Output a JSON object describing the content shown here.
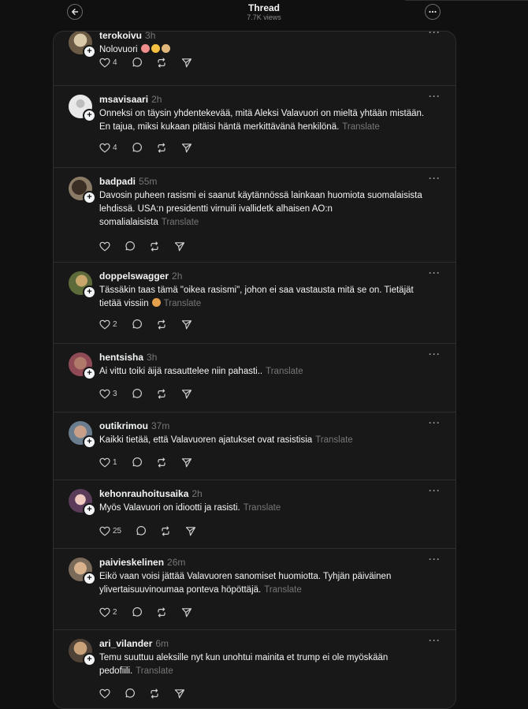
{
  "header": {
    "title": "Thread",
    "views": "7.7K views"
  },
  "posts": [
    {
      "user": "terokoivu",
      "time": "3h",
      "text": "Nolovuori",
      "translate": "",
      "likes": "4",
      "emoji": [
        "#f08d8d",
        "#f6c041",
        "#e0b67a"
      ]
    },
    {
      "user": "msavisaari",
      "time": "2h",
      "text": "Onneksi on täysin yhdentekevää, mitä Aleksi Valavuori on mieltä yhtään mistään. En tajua, miksi kukaan pitäisi häntä merkittävänä henkilönä.",
      "translate": "Translate",
      "likes": "4",
      "emoji": []
    },
    {
      "user": "badpadi",
      "time": "55m",
      "text": "Davosin puheen rasismi ei saanut käytännössä lainkaan huomiota suomalaisista lehdissä. USA:n presidentti virnuili ivallidetk alhaisen AO:n somalialaisista",
      "translate": "Translate",
      "likes": "",
      "emoji": []
    },
    {
      "user": "doppelswagger",
      "time": "2h",
      "text": "Tässäkin taas tämä \"oikea rasismi\", johon ei saa vastausta mitä se on. Tietäjät tietää vissiin",
      "translate": "Translate",
      "likes": "2",
      "emoji": [
        "#e3a14c"
      ]
    },
    {
      "user": "hentsisha",
      "time": "3h",
      "text": "Ai vittu toiki äijä rasauttelee niin pahasti..",
      "translate": "Translate",
      "likes": "3",
      "emoji": []
    },
    {
      "user": "outikrimou",
      "time": "37m",
      "text": "Kaikki tietää, että Valavuoren ajatukset ovat rasistisia",
      "translate": "Translate",
      "likes": "1",
      "emoji": []
    },
    {
      "user": "kehonrauhoitusaika",
      "time": "2h",
      "text": "Myös Valavuori on idiootti ja rasisti.",
      "translate": "Translate",
      "likes": "25",
      "emoji": []
    },
    {
      "user": "paivieskelinen",
      "time": "26m",
      "text": "Eikö vaan voisi jättää Valavuoren sanomiset huomiotta. Tyhjän päiväinen ylivertaisuuvinoumaa ponteva höpöttäjä.",
      "translate": "Translate",
      "likes": "2",
      "emoji": []
    },
    {
      "user": "ari_vilander",
      "time": "6m",
      "text": "Temu suuttuu aleksille nyt kun unohtui mainita et trump ei ole myöskään pedofiili.",
      "translate": "Translate",
      "likes": "",
      "emoji": []
    }
  ],
  "colors": {
    "bg": "#101010",
    "panel": "#181818",
    "border": "#2e2e2e",
    "muted": "#777777"
  },
  "icons": {
    "like": "heart-icon",
    "reply": "reply-bubble-icon",
    "repost": "repost-icon",
    "share": "send-icon"
  }
}
